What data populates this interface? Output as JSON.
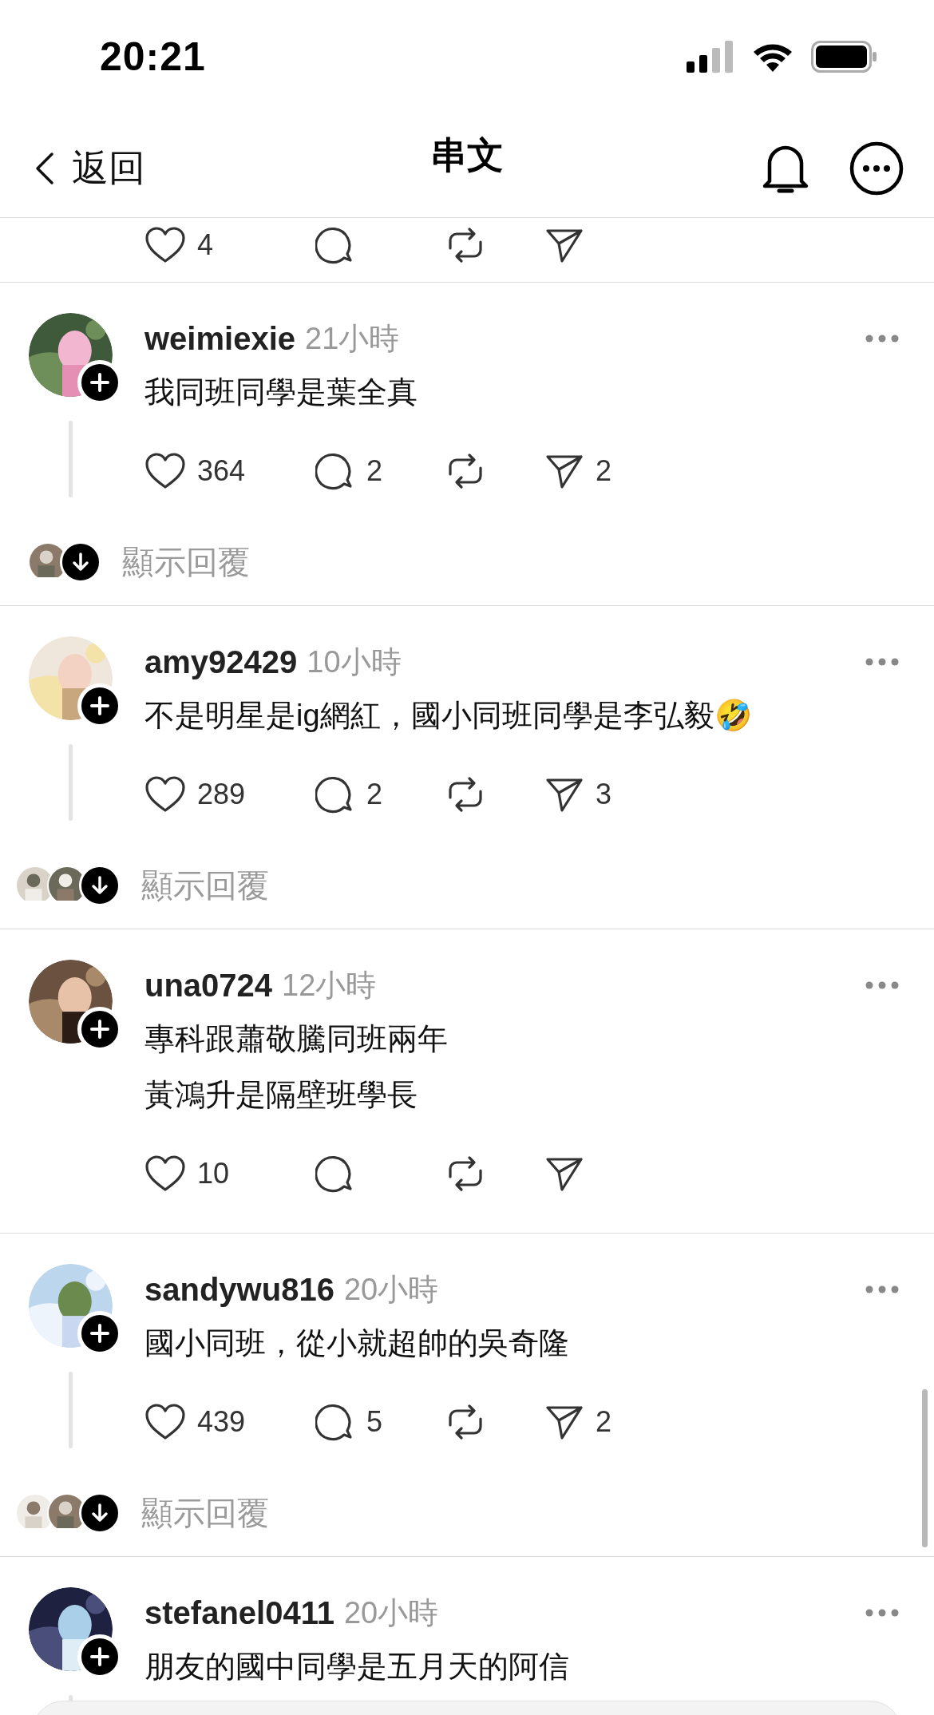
{
  "status_bar": {
    "time": "20:21"
  },
  "header": {
    "back": "返回",
    "title": "串文"
  },
  "previous_post": {
    "likes": "4"
  },
  "posts": [
    {
      "username": "weimiexie",
      "time": "21小時",
      "lines": [
        "我同班同學是葉全真"
      ],
      "thread_line": true,
      "likes": "364",
      "comments": "2",
      "shares": "2",
      "replies": {
        "label": "顯示回覆"
      }
    },
    {
      "username": "amy92429",
      "time": "10小時",
      "lines": [
        "不是明星是ig網紅，國小同班同學是李弘毅🤣"
      ],
      "thread_line": true,
      "likes": "289",
      "comments": "2",
      "shares": "3",
      "replies": {
        "label": "顯示回覆"
      }
    },
    {
      "username": "una0724",
      "time": "12小時",
      "lines": [
        "專科跟蕭敬騰同班兩年",
        "黃鴻升是隔壁班學長"
      ],
      "thread_line": false,
      "likes": "10"
    },
    {
      "username": "sandywu816",
      "time": "20小時",
      "lines": [
        "國小同班，從小就超帥的吳奇隆"
      ],
      "thread_line": true,
      "likes": "439",
      "comments": "5",
      "shares": "2",
      "replies": {
        "label": "顯示回覆"
      }
    },
    {
      "username": "stefanel0411",
      "time": "20小時",
      "lines": [
        "朋友的國中同學是五月天的阿信"
      ],
      "thread_line": true
    }
  ]
}
